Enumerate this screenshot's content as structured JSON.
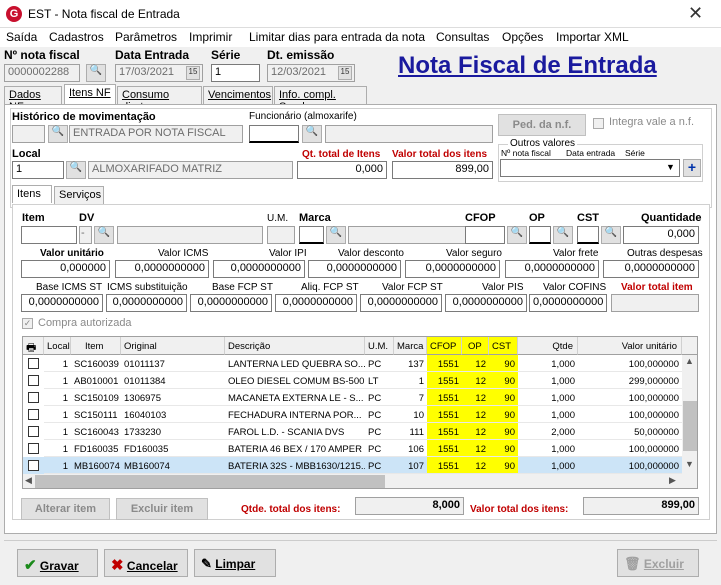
{
  "window": {
    "title": "EST - Nota fiscal de Entrada",
    "close_glyph": "✕",
    "logo_glyph": "G"
  },
  "menu": [
    "Saída",
    "Cadastros",
    "Parâmetros",
    "Imprimir",
    "Limitar dias para entrada da nota",
    "Consultas",
    "Opções",
    "Importar XML"
  ],
  "header": {
    "nota_label": "Nº nota fiscal",
    "nota_value": "0000002288",
    "data_entrada_label": "Data Entrada",
    "data_entrada_value": "17/03/2021",
    "serie_label": "Série",
    "serie_value": "1",
    "dt_emissao_label": "Dt. emissão",
    "dt_emissao_value": "12/03/2021",
    "big_title": "Nota Fiscal de Entrada"
  },
  "tabs": [
    "Dados NF",
    "Itens NF",
    "Consumo direto",
    "Vencimentos",
    "Info. compl. Sped"
  ],
  "itens": {
    "historico_label": "Histórico de movimentação",
    "historico_value": "ENTRADA POR NOTA FISCAL",
    "funcionario_label": "Funcionário (almoxarife)",
    "funcionario_value": "",
    "ped_btn": "Ped. da n.f.",
    "integra_label": "Integra vale a n.f.",
    "local_label": "Local",
    "local_code": "1",
    "local_value": "ALMOXARIFADO MATRIZ",
    "qt_total_label": "Qt. total de Itens",
    "qt_total_value": "0,000",
    "valor_total_label": "Valor total dos itens",
    "valor_total_value": "899,00",
    "outros_label": "Outros valores",
    "outros_cols": [
      "Nº nota fiscal",
      "Data entrada",
      "Série"
    ],
    "plus": "+"
  },
  "subtabs": [
    "Itens",
    "Serviços"
  ],
  "item_fields": {
    "item_label": "Item",
    "dv_label": "DV",
    "um_label": "U.M.",
    "marca_label": "Marca",
    "cfop_label": "CFOP",
    "op_label": "OP",
    "cst_label": "CST",
    "quantidade_label": "Quantidade",
    "quantidade_value": "0,000",
    "dash": "-"
  },
  "row2": [
    {
      "label": "Valor unitário",
      "value": "0,000000",
      "bold": true
    },
    {
      "label": "Valor ICMS",
      "value": "0,0000000000"
    },
    {
      "label": "Valor IPI",
      "value": "0,0000000000"
    },
    {
      "label": "Valor desconto",
      "value": "0,0000000000"
    },
    {
      "label": "Valor seguro",
      "value": "0,0000000000"
    },
    {
      "label": "Valor frete",
      "value": "0,0000000000"
    },
    {
      "label": "Outras despesas",
      "value": "0,0000000000"
    }
  ],
  "row3": [
    {
      "label": "Base ICMS ST",
      "value": "0,0000000000"
    },
    {
      "label": "ICMS substituição",
      "value": "0,0000000000"
    },
    {
      "label": "Base FCP ST",
      "value": "0,0000000000"
    },
    {
      "label": "Aliq. FCP ST",
      "value": "0,0000000000"
    },
    {
      "label": "Valor FCP ST",
      "value": "0,0000000000"
    },
    {
      "label": "Valor PIS",
      "value": "0,0000000000"
    },
    {
      "label": "Valor COFINS",
      "value": "0,0000000000"
    },
    {
      "label": "Valor total item",
      "value": ""
    }
  ],
  "compra_label": "Compra autorizada",
  "grid": {
    "headers": [
      "Local",
      "Item",
      "Original",
      "Descrição",
      "U.M.",
      "Marca",
      "CFOP",
      "OP",
      "CST",
      "Qtde",
      "Valor unitário"
    ],
    "rows": [
      [
        "1",
        "SC160039",
        "01011137",
        "LANTERNA LED QUEBRA SO...",
        "PC",
        "137",
        "1551",
        "12",
        "90",
        "1,000",
        "100,000000"
      ],
      [
        "1",
        "AB010001",
        "01011384",
        "OLEO DIESEL COMUM BS-500",
        "LT",
        "1",
        "1551",
        "12",
        "90",
        "1,000",
        "299,000000"
      ],
      [
        "1",
        "SC150109",
        "1306975",
        "MACANETA EXTERNA LE - S...",
        "PC",
        "7",
        "1551",
        "12",
        "90",
        "1,000",
        "100,000000"
      ],
      [
        "1",
        "SC150111",
        "16040103",
        "FECHADURA INTERNA POR...",
        "PC",
        "10",
        "1551",
        "12",
        "90",
        "1,000",
        "100,000000"
      ],
      [
        "1",
        "SC160043",
        "1733230",
        "FAROL L.D. - SCANIA DVS",
        "PC",
        "111",
        "1551",
        "12",
        "90",
        "2,000",
        "50,000000"
      ],
      [
        "1",
        "FD160035",
        "FD160035",
        "BATERIA 46 BEX / 170 AMPER",
        "PC",
        "106",
        "1551",
        "12",
        "90",
        "1,000",
        "100,000000"
      ],
      [
        "1",
        "MB160074",
        "MB160074",
        "BATERIA 32S - MBB1630/1215...",
        "PC",
        "107",
        "1551",
        "12",
        "90",
        "1,000",
        "100,000000"
      ]
    ]
  },
  "bottom": {
    "alterar": "Alterar item",
    "excluir_item": "Excluir item",
    "qtde_total_label": "Qtde. total dos itens:",
    "qtde_total_value": "8,000",
    "valor_total_label": "Valor total dos itens:",
    "valor_total_value": "899,00"
  },
  "actions": {
    "gravar": "Gravar",
    "cancelar": "Cancelar",
    "limpar": "Limpar",
    "excluir": "Excluir"
  }
}
